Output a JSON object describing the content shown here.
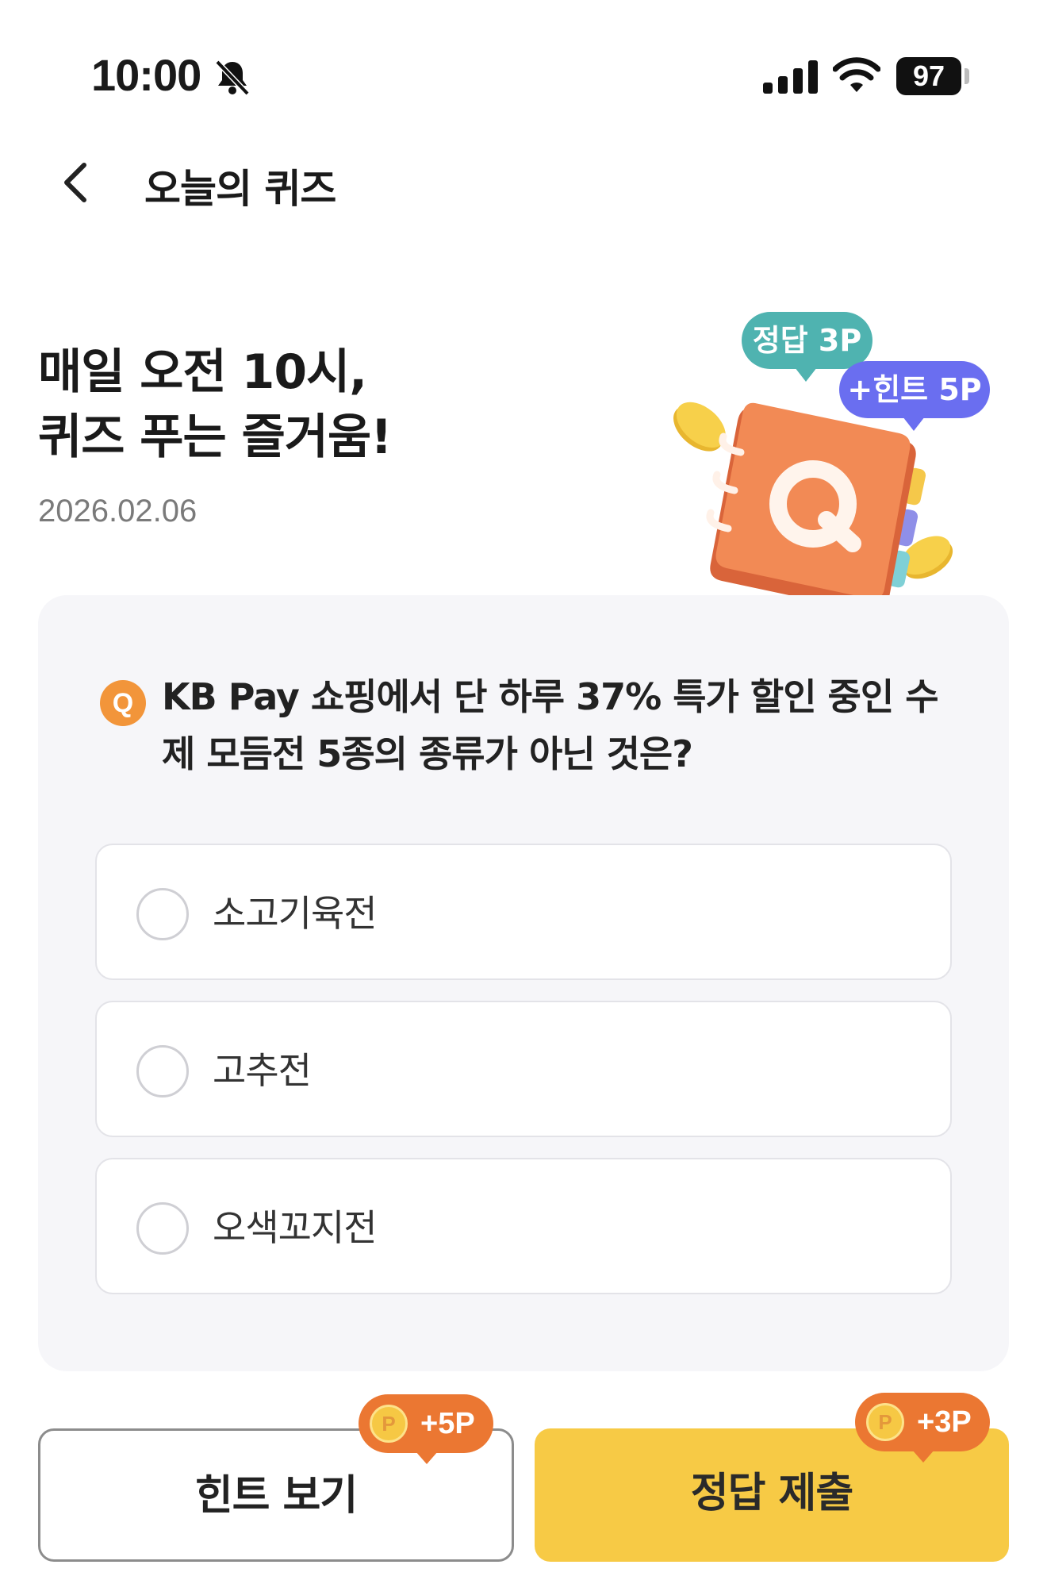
{
  "status_bar": {
    "time": "10:00",
    "battery": "97"
  },
  "header": {
    "title": "오늘의 퀴즈"
  },
  "hero": {
    "line1": "매일 오전 10시,",
    "line2": "퀴즈 푸는 즐거움!",
    "date": "2026.02.06",
    "correct_badge": "정답 3P",
    "hint_badge": "+힌트 5P",
    "icon_letter": "Q"
  },
  "quiz": {
    "badge": "Q",
    "question": "KB Pay 쇼핑에서 단 하루 37% 특가 할인 중인 수제 모듬전 5종의 종류가 아닌 것은?",
    "options": [
      {
        "label": "소고기육전"
      },
      {
        "label": "고추전"
      },
      {
        "label": "오색꼬지전"
      }
    ]
  },
  "buttons": {
    "hint_label": "힌트 보기",
    "hint_points": "+5P",
    "submit_label": "정답 제출",
    "submit_points": "+3P",
    "coin_letter": "P"
  },
  "colors": {
    "accent_yellow": "#f7ca45",
    "orange": "#eb7732",
    "teal": "#4fb3b0",
    "purple": "#6a6ef0",
    "card_bg": "#f6f6f9"
  }
}
